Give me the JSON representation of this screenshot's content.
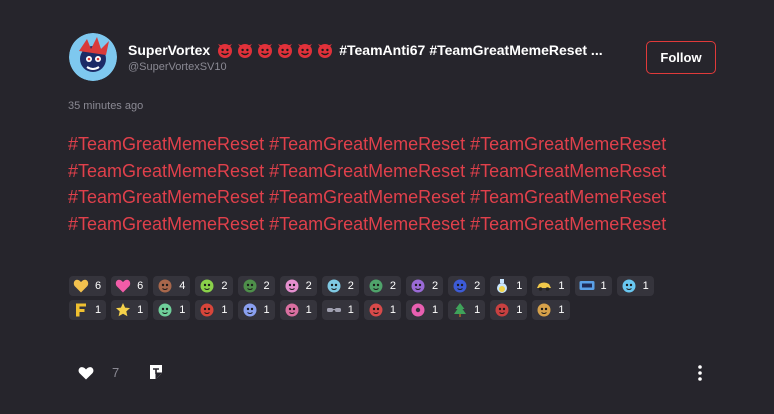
{
  "post": {
    "author_name": "SuperVortex",
    "author_emoji_count": 6,
    "author_tags": [
      "#TeamAnti67",
      "#TeamGreatMemeReset ..."
    ],
    "author_handle": "@SuperVortexSV10",
    "follow_label": "Follow",
    "timestamp": "35 minutes ago",
    "body_lines": [
      "#TeamGreatMemeReset #TeamGreatMemeReset #TeamGreatMemeReset",
      "#TeamGreatMemeReset #TeamGreatMemeReset #TeamGreatMemeReset",
      "#TeamGreatMemeReset #TeamGreatMemeReset #TeamGreatMemeReset",
      "#TeamGreatMemeReset #TeamGreatMemeReset #TeamGreatMemeReset"
    ],
    "like_count": "7"
  },
  "colors": {
    "background": "#26252c",
    "accent_red": "#e0404b",
    "chip_bg": "#35343c",
    "muted": "#8a8993"
  },
  "reactions": [
    {
      "icon": "yellow-heart-icon",
      "color": "#f2c14e",
      "count": "6"
    },
    {
      "icon": "pink-heart-icon",
      "color": "#f25ca8",
      "count": "6"
    },
    {
      "icon": "armadillo-icon",
      "color": "#a8674b",
      "count": "4"
    },
    {
      "icon": "green-creature-icon",
      "color": "#8ad14a",
      "count": "2"
    },
    {
      "icon": "duck-icon",
      "color": "#4e8f4a",
      "count": "2"
    },
    {
      "icon": "party-hat-icon",
      "color": "#e58fcf",
      "count": "2"
    },
    {
      "icon": "cat-face-icon",
      "color": "#7fc9e3",
      "count": "2"
    },
    {
      "icon": "turtle-icon",
      "color": "#4fa36b",
      "count": "2"
    },
    {
      "icon": "purple-creature-icon",
      "color": "#9a6ad6",
      "count": "2"
    },
    {
      "icon": "police-icon",
      "color": "#3d5bd6",
      "count": "2"
    },
    {
      "icon": "potion-icon",
      "color": "#c9e6ff",
      "count": "1"
    },
    {
      "icon": "car-icon",
      "color": "#f0c84a",
      "count": "1"
    },
    {
      "icon": "lol-sign-icon",
      "color": "#5aa0e6",
      "count": "1"
    },
    {
      "icon": "blue-cloud-icon",
      "color": "#69c7f0",
      "count": "1"
    },
    {
      "icon": "letter-f-icon",
      "color": "#f0c030",
      "count": "1"
    },
    {
      "icon": "star-icon",
      "color": "#f5d14a",
      "count": "1"
    },
    {
      "icon": "green-hand-icon",
      "color": "#6fcf9a",
      "count": "1"
    },
    {
      "icon": "red-dragon-icon",
      "color": "#d8453a",
      "count": "1"
    },
    {
      "icon": "gem-icon",
      "color": "#8aa0f0",
      "count": "1"
    },
    {
      "icon": "pink-skull-icon",
      "color": "#d96fa0",
      "count": "1"
    },
    {
      "icon": "sunglasses-icon",
      "color": "#a0a0b0",
      "count": "1"
    },
    {
      "icon": "red-ghost-icon",
      "color": "#d84a4a",
      "count": "1"
    },
    {
      "icon": "donut-icon",
      "color": "#e85fb0",
      "count": "1"
    },
    {
      "icon": "tree-icon",
      "color": "#3fa35a",
      "count": "1"
    },
    {
      "icon": "red-bird-icon",
      "color": "#c84040",
      "count": "1"
    },
    {
      "icon": "lizard-icon",
      "color": "#d6a14a",
      "count": "1"
    }
  ]
}
